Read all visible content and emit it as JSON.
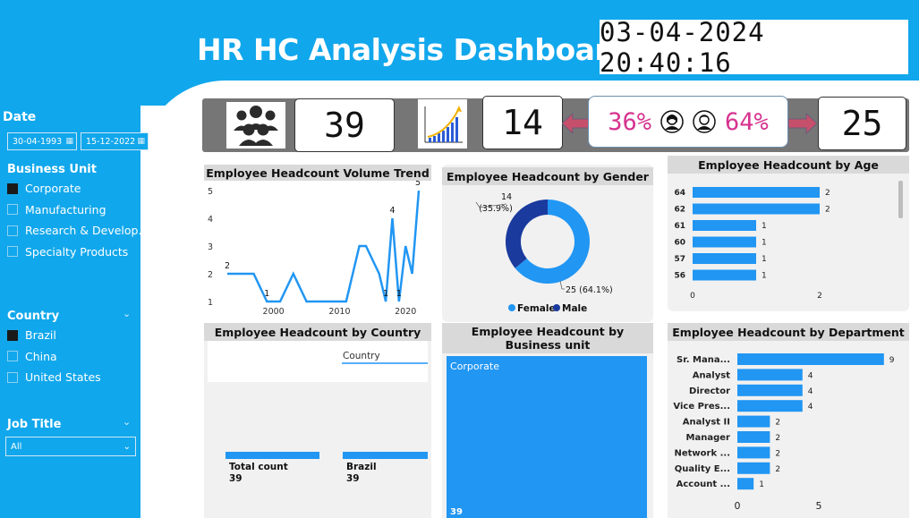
{
  "header": {
    "title": "HR HC Analysis Dashboard",
    "datetime": "03-04-2024 20:40:16"
  },
  "filters": {
    "date": {
      "title": "Date",
      "start": "30-04-1993",
      "end": "15-12-2022"
    },
    "business_unit": {
      "title": "Business Unit",
      "options": [
        {
          "label": "Corporate",
          "checked": true
        },
        {
          "label": "Manufacturing",
          "checked": false
        },
        {
          "label": "Research & Develop...",
          "checked": false
        },
        {
          "label": "Specialty Products",
          "checked": false
        }
      ]
    },
    "country": {
      "title": "Country",
      "options": [
        {
          "label": "Brazil",
          "checked": true
        },
        {
          "label": "China",
          "checked": false
        },
        {
          "label": "United States",
          "checked": false
        }
      ]
    },
    "job_title": {
      "title": "Job Title",
      "selected": "All"
    }
  },
  "kpis": {
    "total_headcount": "39",
    "growth_value": "14",
    "female_pct": "36%",
    "male_pct": "64%",
    "male_count": "25",
    "icons": {
      "headcount": "people-group-icon",
      "growth": "growth-chart-icon",
      "female": "female-avatar-icon",
      "male": "male-avatar-icon",
      "left_arrow": "arrow-left-icon",
      "right_arrow": "arrow-right-icon"
    },
    "accent": "#d6338f"
  },
  "colors": {
    "brand": "#11a7ec",
    "bar": "#2196f3",
    "male": "#1a3a9e",
    "female": "#2196f3",
    "line": "#2196f3"
  },
  "chart_data": [
    {
      "id": "volume-trend",
      "type": "line",
      "title": "Employee Headcount Volume Trend",
      "x": [
        1993,
        1995,
        1997,
        1999,
        2001,
        2003,
        2005,
        2007,
        2009,
        2011,
        2013,
        2014,
        2016,
        2017,
        2018,
        2019,
        2020,
        2021,
        2022
      ],
      "y": [
        2,
        2,
        2,
        1,
        1,
        2,
        1,
        1,
        1,
        1,
        3,
        3,
        2,
        1,
        4,
        1,
        3,
        2,
        5
      ],
      "point_labels": [
        {
          "x": 1993,
          "y": 2,
          "text": "2"
        },
        {
          "x": 1999,
          "y": 1,
          "text": "1"
        },
        {
          "x": 2017,
          "y": 1,
          "text": "1"
        },
        {
          "x": 2018,
          "y": 4,
          "text": "4"
        },
        {
          "x": 2019,
          "y": 1,
          "text": "1"
        },
        {
          "x": 2022,
          "y": 5,
          "text": "5"
        }
      ],
      "x_ticks": [
        "2000",
        "2010",
        "2020"
      ],
      "y_ticks": [
        "1",
        "2",
        "3",
        "4",
        "5"
      ],
      "ylim": [
        1,
        5
      ]
    },
    {
      "id": "gender",
      "type": "pie",
      "title": "Employee Headcount by Gender",
      "slices": [
        {
          "label": "Female",
          "value": 25,
          "pct": "64.1%",
          "display": "25 (64.1%)"
        },
        {
          "label": "Male",
          "value": 14,
          "pct": "35.9%",
          "display": "14\n(35.9%)"
        }
      ],
      "legend": [
        "Female",
        "Male"
      ],
      "male_label_count": "14",
      "male_label_pct": "(35.9%)",
      "female_label": "25 (64.1%)"
    },
    {
      "id": "age",
      "type": "bar",
      "title": "Employee Headcount by Age",
      "categories": [
        "64",
        "62",
        "61",
        "60",
        "57",
        "56"
      ],
      "values": [
        2,
        2,
        1,
        1,
        1,
        1
      ],
      "x_ticks": [
        "0",
        "2"
      ],
      "xlim": [
        0,
        2
      ]
    },
    {
      "id": "country",
      "type": "bar",
      "title": "Employee Headcount by Country",
      "legend_label": "Country",
      "categories": [
        "Total count",
        "Brazil"
      ],
      "values": [
        39,
        39
      ]
    },
    {
      "id": "business-unit",
      "type": "bar",
      "title": "Employee Headcount by Business unit",
      "categories": [
        "Corporate"
      ],
      "values": [
        39
      ]
    },
    {
      "id": "department",
      "type": "bar",
      "title": "Employee Headcount by Department",
      "categories": [
        "Sr. Mana...",
        "Analyst",
        "Director",
        "Vice Pres...",
        "Analyst II",
        "Manager",
        "Network ...",
        "Quality E...",
        "Account ..."
      ],
      "values": [
        9,
        4,
        4,
        4,
        2,
        2,
        2,
        2,
        1
      ],
      "x_ticks": [
        "0",
        "5"
      ],
      "xlim": [
        0,
        10
      ]
    }
  ]
}
